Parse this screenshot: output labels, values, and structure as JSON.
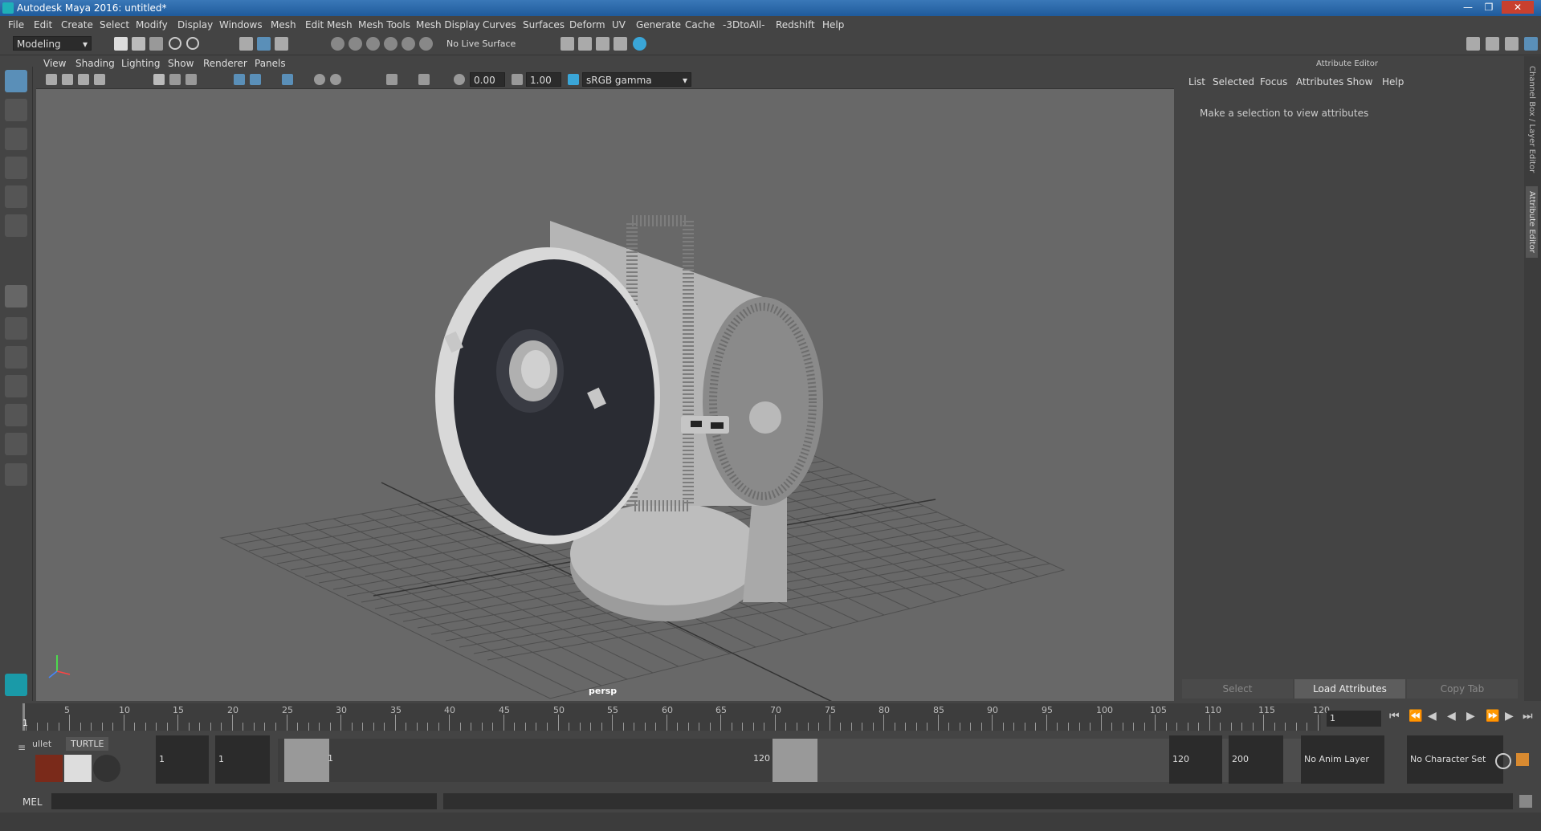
{
  "window": {
    "title": "Autodesk Maya 2016: untitled*",
    "min": "—",
    "max": "❐",
    "close": "✕"
  },
  "menu": [
    "File",
    "Edit",
    "Create",
    "Select",
    "Modify",
    "Display",
    "Windows",
    "Mesh",
    "Edit Mesh",
    "Mesh Tools",
    "Mesh Display",
    "Curves",
    "Surfaces",
    "Deform",
    "UV",
    "Generate",
    "Cache",
    "-3DtoAll-",
    "Redshift",
    "Help"
  ],
  "shelf": {
    "mode": "Modeling",
    "live_surface": "No Live Surface"
  },
  "viewport": {
    "menu": [
      "View",
      "Shading",
      "Lighting",
      "Show",
      "Renderer",
      "Panels"
    ],
    "exposure": "0.00",
    "gamma": "1.00",
    "color_space": "sRGB gamma",
    "camera": "persp"
  },
  "attribute_editor": {
    "title": "Attribute Editor",
    "menu": [
      "List",
      "Selected",
      "Focus",
      "Attributes",
      "Show",
      "Help"
    ],
    "message": "Make a selection to view attributes",
    "buttons": {
      "select": "Select",
      "load": "Load Attributes",
      "copy": "Copy Tab"
    },
    "side_tabs": [
      "Channel Box / Layer Editor",
      "Attribute Editor"
    ]
  },
  "timeline": {
    "ticks": [
      "5",
      "10",
      "15",
      "20",
      "25",
      "30",
      "35",
      "40",
      "45",
      "50",
      "55",
      "60",
      "65",
      "70",
      "75",
      "80",
      "85",
      "90",
      "95",
      "100",
      "105",
      "110",
      "115",
      "120"
    ],
    "current": "1",
    "start_label": "1",
    "current_frame": "1"
  },
  "range": {
    "shelf_tabs": [
      "ullet",
      "TURTLE"
    ],
    "start": "1",
    "playback_start": "1",
    "slider_start": "1",
    "slider_end": "120",
    "playback_end": "120",
    "end": "200",
    "anim_layer": "No Anim Layer",
    "char_set": "No Character Set"
  },
  "command_line": {
    "label": "MEL"
  }
}
